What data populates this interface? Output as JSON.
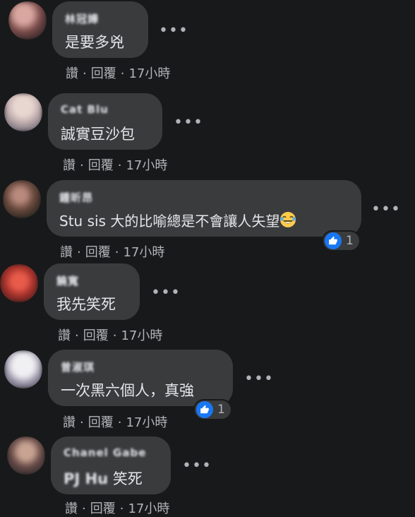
{
  "comments": [
    {
      "author": "林冠嬅",
      "text": "是要多兇",
      "actions": {
        "like": "讚",
        "reply": "回覆",
        "time": "17小時"
      },
      "more": "•••"
    },
    {
      "author": "Cat Blu",
      "text": "誠實豆沙包",
      "actions": {
        "like": "讚",
        "reply": "回覆",
        "time": "17小時"
      },
      "more": "•••"
    },
    {
      "author": "鍾昕昂",
      "text": "Stu sis 大的比喻總是不會讓人失望",
      "emoji": "tears-of-joy-emoji",
      "actions": {
        "like": "讚",
        "reply": "回覆",
        "time": "17小時"
      },
      "reaction": {
        "icon": "like-icon",
        "count": "1"
      },
      "more": "•••"
    },
    {
      "author": "饒寬",
      "text": "我先笑死",
      "actions": {
        "like": "讚",
        "reply": "回覆",
        "time": "17小時"
      },
      "more": "•••"
    },
    {
      "author": "曾淑琪",
      "text": "一次黑六個人，真強",
      "actions": {
        "like": "讚",
        "reply": "回覆",
        "time": "17小時"
      },
      "reaction": {
        "icon": "like-icon",
        "count": "1"
      },
      "more": "•••"
    },
    {
      "author": "Chanel Gabe",
      "mention": "PJ Hu",
      "text": "笑死",
      "actions": {
        "like": "讚",
        "reply": "回覆",
        "time": "17小時"
      },
      "more": "•••"
    }
  ],
  "colors": {
    "background": "#18191a",
    "bubble": "#3a3b3c",
    "text": "#e4e6eb",
    "secondary": "#b0b3b8",
    "like_blue": "#1877f2"
  }
}
